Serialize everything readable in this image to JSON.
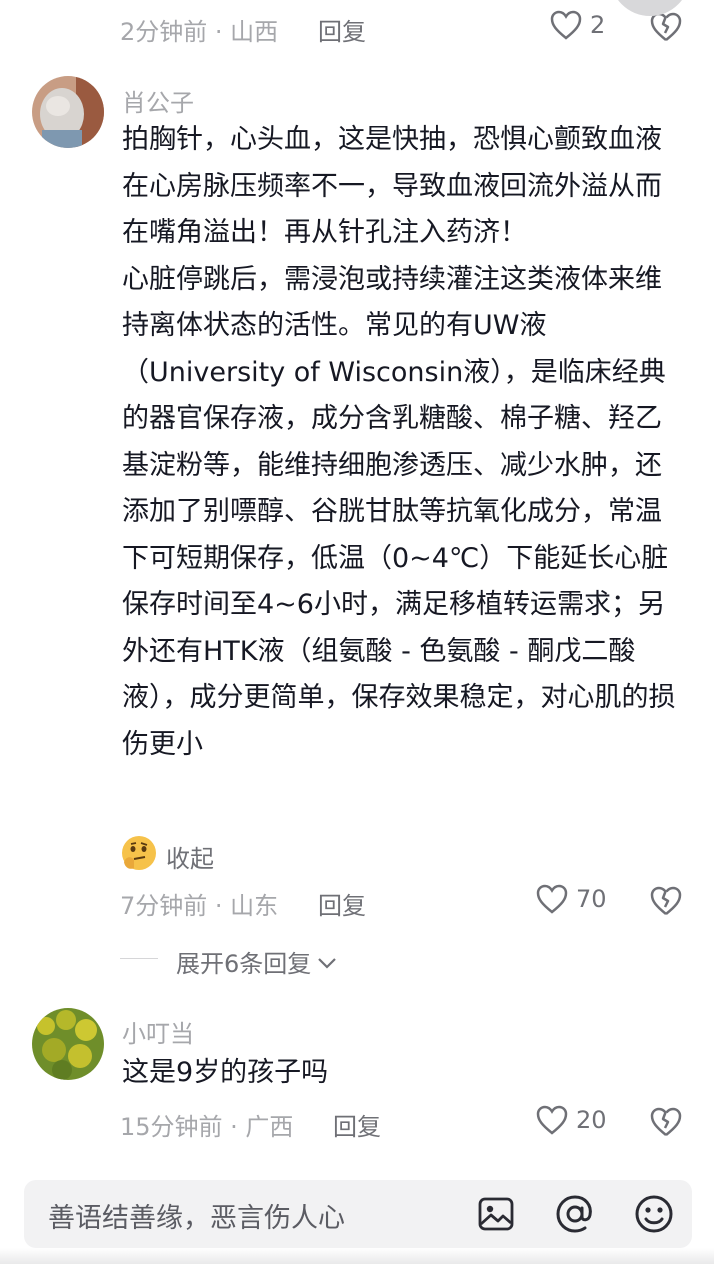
{
  "comments": [
    {
      "time_location": "2分钟前 · 山西",
      "reply_label": "回复",
      "likes": "2"
    },
    {
      "username": "肖公子",
      "text_para1": "拍胸针，心头血，这是快抽，恐惧心颤致血液在心房脉压频率不一，导致血液回流外溢从而在嘴角溢出！再从针孔注入药济！",
      "text_para2": "心脏停跳后，需浸泡或持续灌注这类液体来维持离体状态的活性。常见的有UW液（University of Wisconsin液），是临床经典的器官保存液，成分含乳糖酸、棉子糖、羟乙基淀粉等，能维持细胞渗透压、减少水肿，还添加了别嘌醇、谷胱甘肽等抗氧化成分，常温下可短期保存，低温（0~4℃）下能延长心脏保存时间至4~6小时，满足移植转运需求；另外还有HTK液（组氨酸 - 色氨酸 - 酮戊二酸液），成分更简单，保存效果稳定，对心肌的损伤更小",
      "collapse_label": "收起",
      "time_location": "7分钟前 · 山东",
      "reply_label": "回复",
      "likes": "70",
      "expand_label": "展开6条回复"
    },
    {
      "username": "小叮当",
      "text": "这是9岁的孩子吗",
      "time_location": "15分钟前 · 广西",
      "reply_label": "回复",
      "likes": "20"
    }
  ],
  "input_bar": {
    "placeholder": "善语结善缘，恶言伤人心",
    "icons": [
      "image-icon",
      "at-icon",
      "emoji-icon"
    ]
  },
  "colors": {
    "text": "#161823",
    "meta": "#a6a7ab",
    "action": "#6f7076",
    "bar_bg": "#f2f2f3"
  }
}
